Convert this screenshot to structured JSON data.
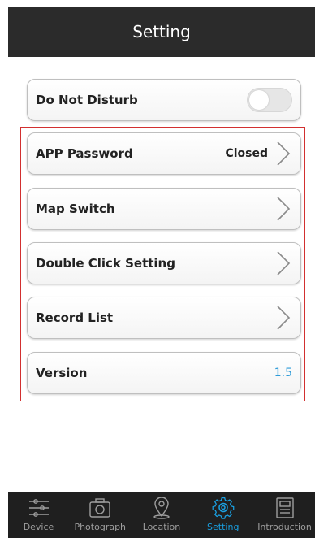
{
  "header": {
    "title": "Setting"
  },
  "do_not_disturb": {
    "label": "Do Not Disturb",
    "enabled": false
  },
  "settings_list": [
    {
      "label": "APP Password",
      "value": "Closed"
    },
    {
      "label": "Map Switch"
    },
    {
      "label": "Double Click Setting"
    },
    {
      "label": "Record List"
    },
    {
      "label": "Version",
      "value": "1.5"
    }
  ],
  "tabs": [
    {
      "label": "Device",
      "icon": "device-list-icon"
    },
    {
      "label": "Photograph",
      "icon": "camera-icon"
    },
    {
      "label": "Location",
      "icon": "location-pin-icon"
    },
    {
      "label": "Setting",
      "icon": "gear-icon",
      "active": true
    },
    {
      "label": "Introduction",
      "icon": "introduction-icon"
    }
  ],
  "colors": {
    "accent": "#1a9fe0",
    "header_bg": "#2b2b2b",
    "highlight_border": "#d23030",
    "version_value": "#2e9bd8"
  }
}
